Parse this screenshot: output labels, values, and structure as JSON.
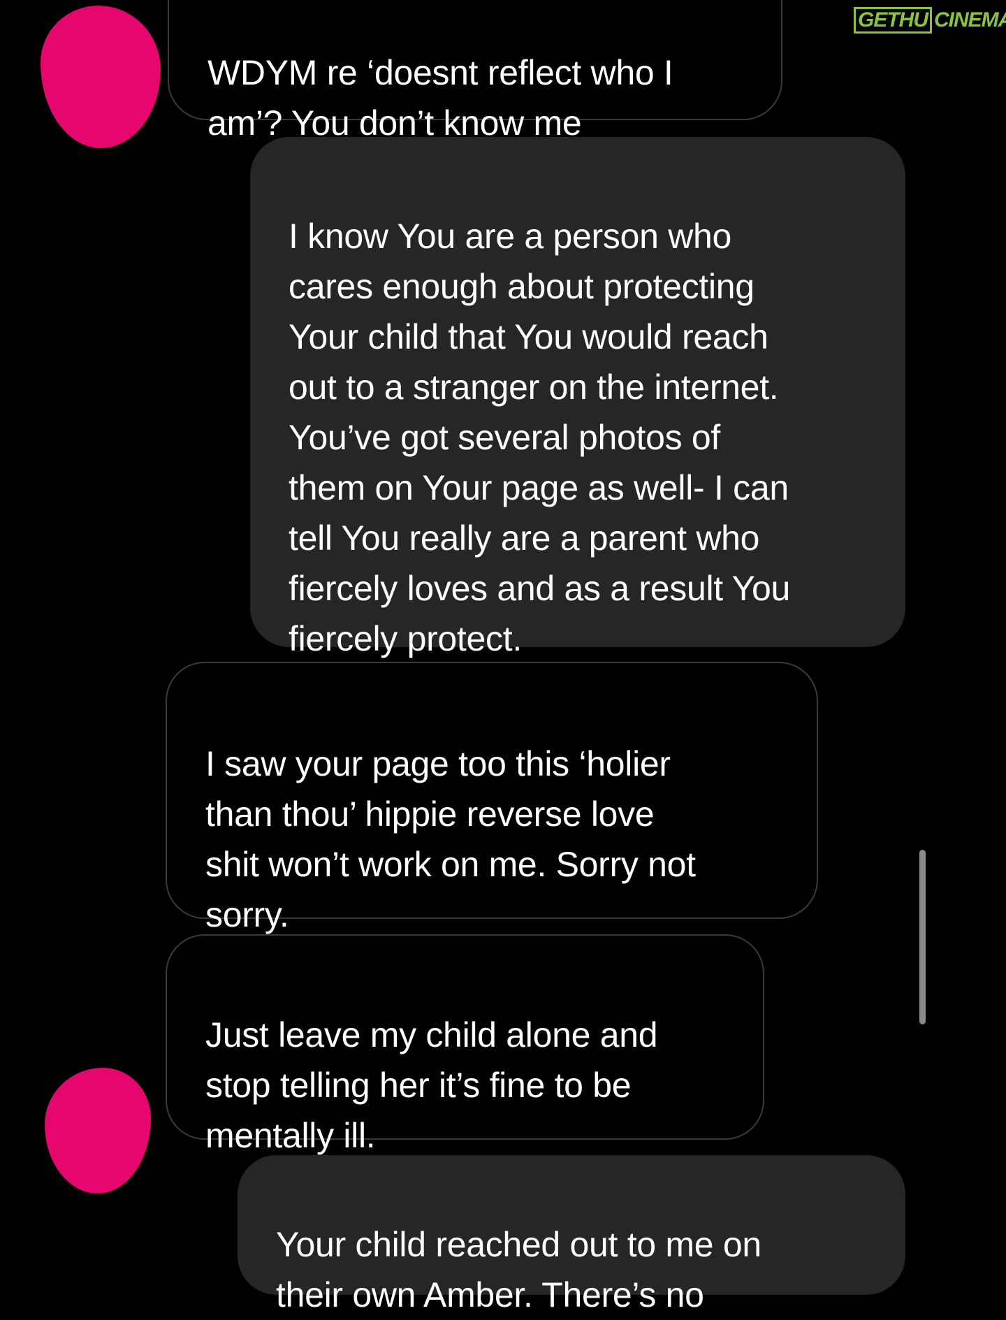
{
  "watermark": {
    "box_text": "GETHU",
    "text": "CINEMA"
  },
  "messages": [
    {
      "id": "msg-1",
      "direction": "incoming",
      "text": "WDYM re ‘doesnt reflect who I\nam’? You don’t know me"
    },
    {
      "id": "msg-2",
      "direction": "outgoing",
      "text": "I know You are a person who\ncares enough about protecting\nYour child that You would reach\nout to a stranger on the internet.\nYou’ve got several photos of\nthem on Your page as well- I can\ntell You really are a parent who\nfiercely loves and as a result You\nfiercely protect."
    },
    {
      "id": "msg-3",
      "direction": "incoming",
      "text": "I saw your page too this ‘holier\nthan thou’ hippie reverse love\nshit won’t work on me. Sorry not\nsorry."
    },
    {
      "id": "msg-4",
      "direction": "incoming",
      "text": "Just leave my child alone and\nstop telling her it’s fine to be\nmentally ill."
    },
    {
      "id": "msg-5",
      "direction": "outgoing",
      "text": "Your child reached out to me on\ntheir own Amber. There’s no"
    }
  ],
  "colors": {
    "background": "#000000",
    "incoming_border": "#3a3a3a",
    "outgoing_bubble": "#262626",
    "redaction": "#e5066e",
    "watermark": "#8ac43f"
  }
}
